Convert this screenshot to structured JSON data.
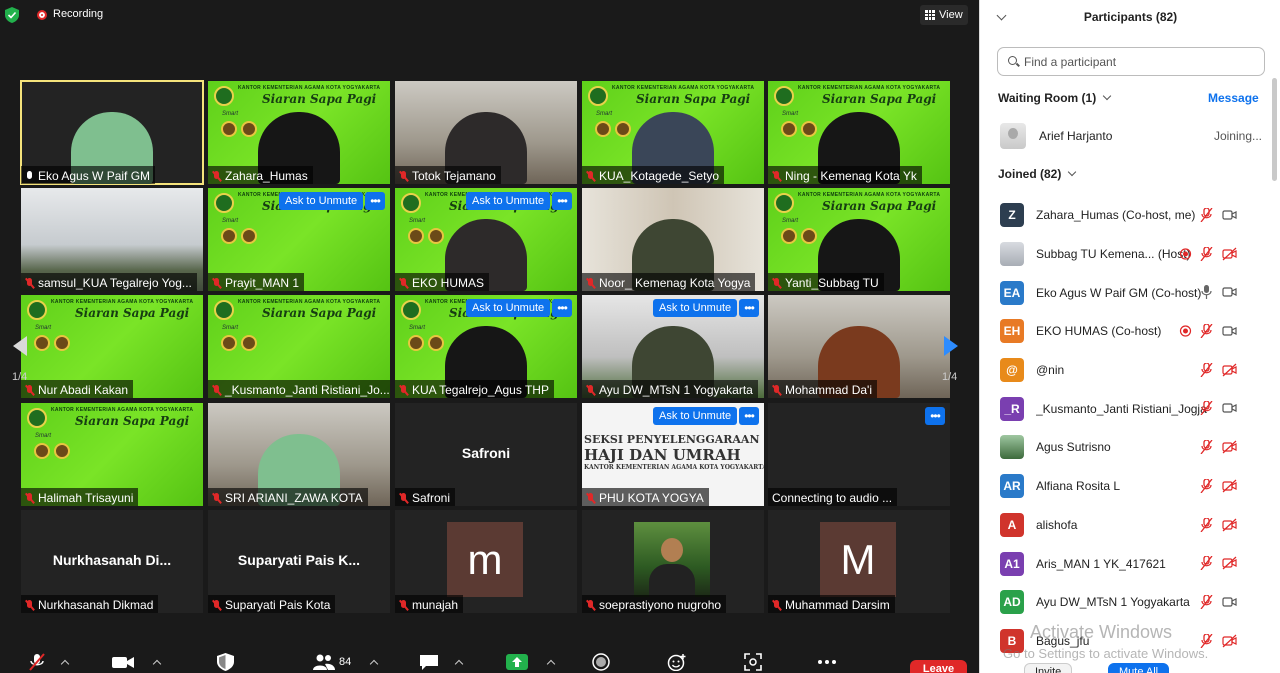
{
  "recording": {
    "label": "Recording"
  },
  "view": {
    "label": "View"
  },
  "pagination": {
    "left": "1/4",
    "right": "1/4"
  },
  "tiles": [
    {
      "name": "Eko Agus W Paif GM",
      "mic": "on"
    },
    {
      "name": "Zahara_Humas"
    },
    {
      "name": "Totok Tejamano"
    },
    {
      "name": "KUA_Kotagede_Setyo"
    },
    {
      "name": "Ning - Kemenag Kota Yk"
    },
    {
      "name": "samsul_KUA Tegalrejo Yog..."
    },
    {
      "name": "Prayit_MAN 1"
    },
    {
      "name": "EKO HUMAS"
    },
    {
      "name": "Noor_ Kemenag Kota Yogya"
    },
    {
      "name": "Yanti_Subbag TU"
    },
    {
      "name": "Nur Abadi Kakan"
    },
    {
      "name": "_Kusmanto_Janti Ristiani_Jo..."
    },
    {
      "name": "KUA Tegalrejo_Agus THP"
    },
    {
      "name": "Ayu DW_MTsN 1 Yogyakarta"
    },
    {
      "name": "Mohammad Da'i"
    },
    {
      "name": "Halimah Trisayuni"
    },
    {
      "name": "SRI ARIANI_ZAWA KOTA"
    },
    {
      "name": "Safroni",
      "center": "Safroni"
    },
    {
      "name": "PHU KOTA YOGYA",
      "banner": [
        "SEKSI PENYELENGGARAAN",
        "HAJI DAN UMRAH",
        "KANTOR KEMENTERIAN AGAMA KOTA YOGYAKARTA"
      ]
    },
    {
      "name": "Connecting to audio ..."
    },
    {
      "name": "Nurkhasanah Dikmad",
      "center": "Nurkhasanah  Di..."
    },
    {
      "name": "Suparyati Pais Kota",
      "center": "Suparyati Pais K..."
    },
    {
      "name": "munajah",
      "letter": "m"
    },
    {
      "name": "soeprastiyono nugroho"
    },
    {
      "name": "Muhammad Darsim",
      "letter": "M"
    }
  ],
  "banner": {
    "head": "KANTOR KEMENTERIAN AGAMA KOTA YOGYAKARTA",
    "title": "Siaran Sapa Pagi",
    "smart": "Smart"
  },
  "ask_unmute": "Ask to Unmute",
  "more_dots": "•••",
  "toolbar": {
    "participants_count": "84",
    "leave": "Leave"
  },
  "panel": {
    "title": "Participants (82)",
    "search_placeholder": "Find a participant",
    "waiting_room": "Waiting Room (1)",
    "message": "Message",
    "waiting": {
      "name": "Arief Harjanto",
      "status": "Joining..."
    },
    "joined": "Joined (82)",
    "participants": [
      {
        "initials": "Z",
        "color": "#2d3e50",
        "name": "Zahara_Humas (Co-host, me)",
        "rec": false,
        "mic": "muted",
        "video": "on"
      },
      {
        "initials": "",
        "color": "img-gray",
        "name": "Subbag TU Kemena...  (Host)",
        "rec": true,
        "mic": "muted",
        "video": "off"
      },
      {
        "initials": "EA",
        "color": "#2a7ac9",
        "name": "Eko Agus W Paif GM (Co-host)",
        "rec": false,
        "mic": "on",
        "video": "on"
      },
      {
        "initials": "EH",
        "color": "#e87a25",
        "name": "EKO HUMAS (Co-host)",
        "rec": true,
        "mic": "muted",
        "video": "on"
      },
      {
        "initials": "@",
        "color": "#e88a1a",
        "name": "@nin",
        "rec": false,
        "mic": "muted",
        "video": "off"
      },
      {
        "initials": "_R",
        "color": "#7a3fb0",
        "name": "_Kusmanto_Janti Ristiani_Jogja",
        "rec": false,
        "mic": "muted",
        "video": "on"
      },
      {
        "initials": "",
        "color": "img-person",
        "name": "Agus Sutrisno",
        "rec": false,
        "mic": "muted",
        "video": "off"
      },
      {
        "initials": "AR",
        "color": "#2a7ac9",
        "name": "Alfiana Rosita L",
        "rec": false,
        "mic": "muted",
        "video": "off"
      },
      {
        "initials": "A",
        "color": "#d0342c",
        "name": "alishofa",
        "rec": false,
        "mic": "muted",
        "video": "off"
      },
      {
        "initials": "A1",
        "color": "#7a3fb0",
        "name": "Aris_MAN 1 YK_417621",
        "rec": false,
        "mic": "muted",
        "video": "off"
      },
      {
        "initials": "AD",
        "color": "#2aa14a",
        "name": "Ayu DW_MTsN 1 Yogyakarta",
        "rec": false,
        "mic": "muted",
        "video": "on"
      },
      {
        "initials": "B",
        "color": "#d0342c",
        "name": "Bagus_jfu",
        "rec": false,
        "mic": "muted",
        "video": "off"
      }
    ],
    "invite": "Invite",
    "mute_all": "Mute All"
  },
  "watermark": {
    "title": "Activate Windows",
    "sub": "Go to Settings to activate Windows."
  },
  "colors": {
    "zoom_blue": "#0e72ed",
    "muted_red": "#e02828",
    "selected_border": "#f5e37b"
  }
}
